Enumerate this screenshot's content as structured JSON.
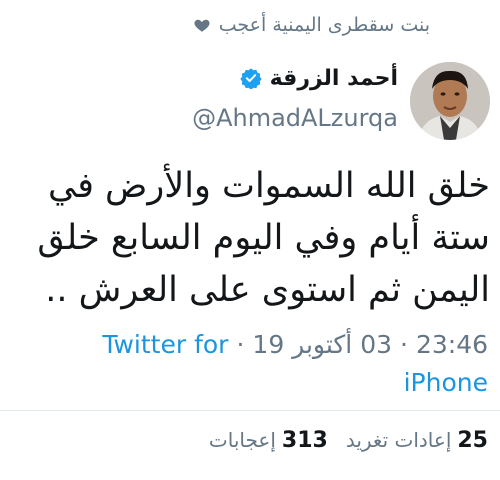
{
  "context": {
    "text": "بنت سقطرى اليمنية أعجب",
    "icon": "heart-icon"
  },
  "author": {
    "name": "أحمد الزرقة",
    "handle": "@AhmadALzurqa",
    "verified": true,
    "verified_icon": "verified-badge-icon"
  },
  "tweet": {
    "lines": [
      "خلق الله السموات والأرض في",
      "ستة أيام وفي اليوم السابع خلق",
      "اليمن ثم استوى على العرش .."
    ]
  },
  "meta": {
    "time": "23:46",
    "date": "03 أكتوبر 19",
    "source_part1": "Twitter for",
    "source_part2": "iPhone",
    "separator": "·"
  },
  "stats": {
    "retweets_count": "25",
    "retweets_label": "إعادات تغريد",
    "likes_count": "313",
    "likes_label": "إعجابات"
  },
  "colors": {
    "link": "#1b95e0",
    "secondary_text": "#657786",
    "primary_text": "#14171a",
    "verified": "#1da1f2"
  }
}
